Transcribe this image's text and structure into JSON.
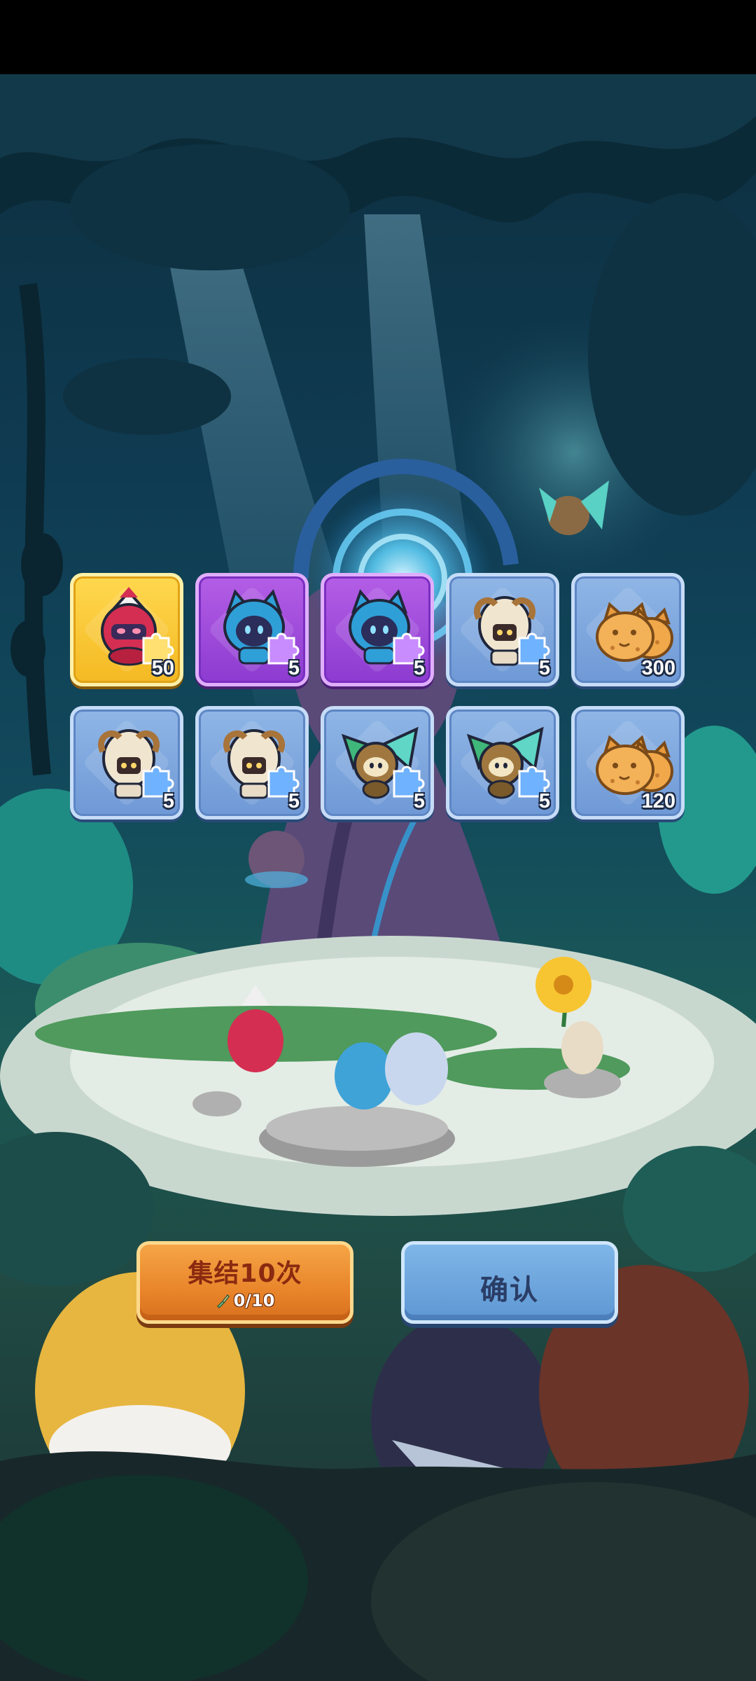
{
  "rewards": [
    {
      "item": "red-knight-hero-shard",
      "rarity": "gold",
      "count": "50"
    },
    {
      "item": "blue-cat-hero-shard",
      "rarity": "purple",
      "count": "5"
    },
    {
      "item": "blue-cat-hero-shard",
      "rarity": "purple",
      "count": "5"
    },
    {
      "item": "ram-helmet-hero-shard",
      "rarity": "blue",
      "count": "5"
    },
    {
      "item": "cookie-cat-currency",
      "rarity": "blue",
      "count": "300"
    },
    {
      "item": "ram-helmet-hero-shard",
      "rarity": "blue",
      "count": "5"
    },
    {
      "item": "ram-helmet-hero-shard",
      "rarity": "blue",
      "count": "5"
    },
    {
      "item": "leaf-fairy-hero-shard",
      "rarity": "blue",
      "count": "5"
    },
    {
      "item": "leaf-fairy-hero-shard",
      "rarity": "blue",
      "count": "5"
    },
    {
      "item": "cookie-cat-currency",
      "rarity": "blue",
      "count": "120"
    }
  ],
  "buttons": {
    "summon_label": "集结10次",
    "summon_cost": "0/10",
    "confirm_label": "确认"
  },
  "colors": {
    "gold": "#f4b923",
    "purple": "#8c3bd0",
    "blue": "#6f99d6",
    "summon_button": "#e9852a",
    "confirm_button": "#5e97d3"
  }
}
